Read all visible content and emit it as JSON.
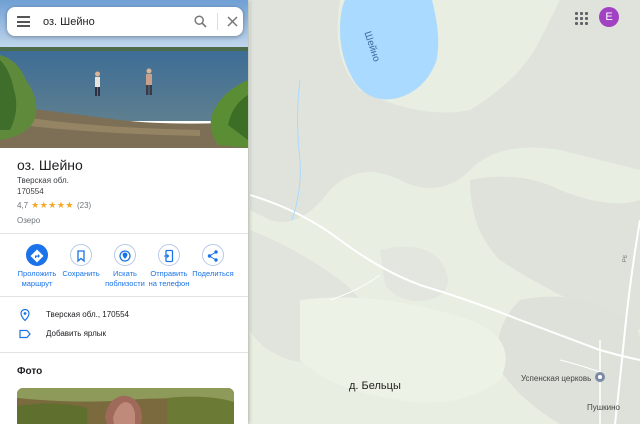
{
  "search": {
    "query": "оз. Шейно"
  },
  "place": {
    "title": "оз. Шейно",
    "region": "Тверская обл.",
    "postcode": "170554",
    "rating": "4,7",
    "rating_value": 4.7,
    "review_count": "(23)",
    "category": "Озеро"
  },
  "actions": [
    {
      "label_line1": "Проложить",
      "label_line2": "маршрут",
      "icon": "directions-icon"
    },
    {
      "label_line1": "Сохранить",
      "label_line2": "",
      "icon": "bookmark-icon"
    },
    {
      "label_line1": "Искать",
      "label_line2": "поблизости",
      "icon": "nearby-icon"
    },
    {
      "label_line1": "Отправить",
      "label_line2": "на телефон",
      "icon": "send-to-phone-icon"
    },
    {
      "label_line1": "Поделиться",
      "label_line2": "",
      "icon": "share-icon"
    }
  ],
  "info": {
    "address": "Тверская обл., 170554",
    "add_label": "Добавить ярлык"
  },
  "photos_section": {
    "title": "Фото"
  },
  "map": {
    "lake_label": "Шейно",
    "village_label": "д. Бельцы",
    "church_label": "Успенская церковь",
    "pushkino_label": "Пушкино",
    "road_label": "Р6"
  },
  "account": {
    "avatar_letter": "E"
  },
  "colors": {
    "accent": "#1a73e8",
    "water": "#aadaff",
    "avatar": "#a142c2",
    "pin": "#ea4335",
    "star": "#f5a623"
  }
}
